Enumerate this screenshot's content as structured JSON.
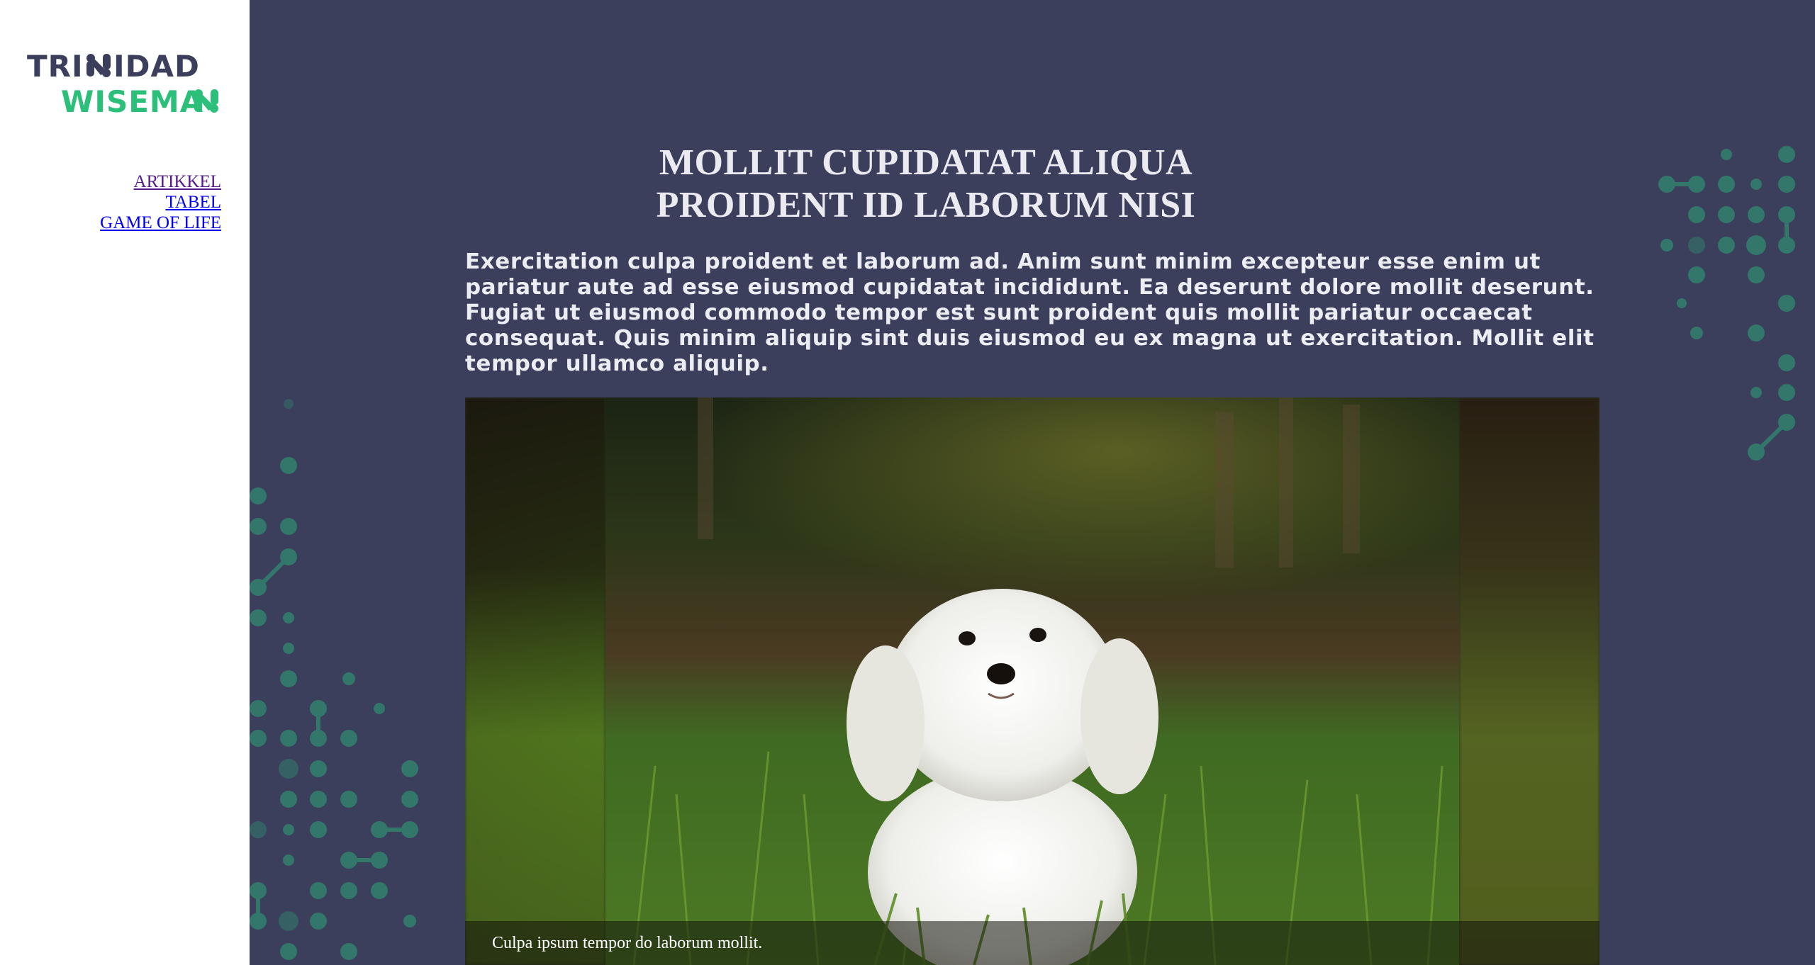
{
  "sidebar": {
    "logo": {
      "line1": "TRINIDAD",
      "line2": "WISEMAN",
      "colors": {
        "line1": "#3b3f5c",
        "line2": "#2bbf7a"
      }
    },
    "nav": [
      {
        "label": "ARTIKKEL",
        "visited": true
      },
      {
        "label": "TABEL",
        "visited": false
      },
      {
        "label": "GAME OF LIFE",
        "visited": false
      }
    ]
  },
  "main": {
    "background": "#3b3f5c",
    "title_line1": "MOLLIT CUPIDATAT ALIQUA",
    "title_line2": "PROIDENT ID LABORUM NISI",
    "lede": "Exercitation culpa proident et laborum ad. Anim sunt minim excepteur esse enim ut pariatur aute ad esse eiusmod cupidatat incididunt. Ea deserunt dolore mollit deserunt. Fugiat ut eiusmod commodo tempor est sunt proident quis mollit pariatur occaecat consequat. Quis minim aliquip sint duis eiusmod eu ex magna ut exercitation. Mollit elit tempor ullamco aliquip.",
    "figure": {
      "subject": "white puppy sitting in grass",
      "caption": "Culpa ipsum tempor do laborum mollit."
    },
    "decor": {
      "dot_color": "#2f8a6e"
    }
  }
}
